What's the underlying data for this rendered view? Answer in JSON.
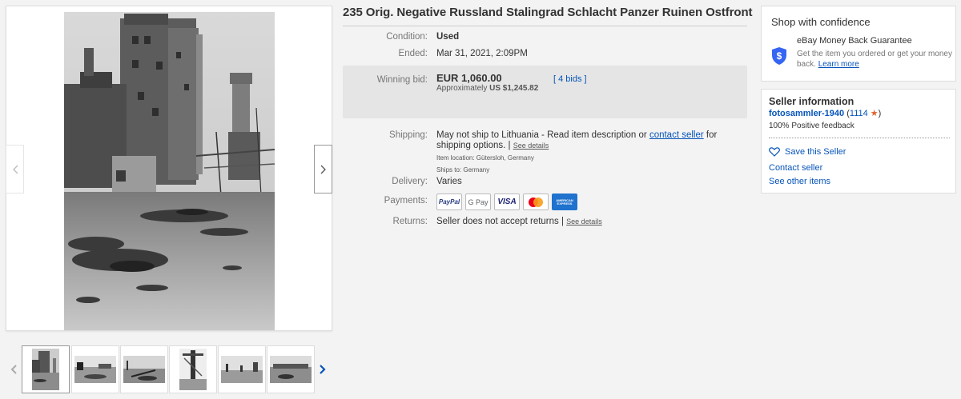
{
  "item": {
    "title": "235 Orig. Negative Russland Stalingrad Schlacht Panzer Ruinen Ostfront",
    "condition_label": "Condition:",
    "condition_value": "Used",
    "ended_label": "Ended:",
    "ended_value": "Mar 31, 2021, 2:09PM",
    "winning_label": "Winning bid:",
    "winning_value": "EUR 1,060.00",
    "approx_prefix": "Approximately",
    "approx_value": "US $1,245.82",
    "bids_open": "[",
    "bids_link": "4 bids",
    "bids_close": "]",
    "shipping_label": "Shipping:",
    "shipping_text": "May not ship to Lithuania - Read item description or",
    "contact_seller_link": "contact seller",
    "shipping_text_2": "for shipping",
    "shipping_text_3": "options. |",
    "see_details": "See details",
    "item_location": "Item location:  Gütersloh, Germany",
    "ships_to": "Ships to:  Germany",
    "delivery_label": "Delivery:",
    "delivery_value": "Varies",
    "payments_label": "Payments:",
    "payment_methods": [
      "PayPal",
      "G Pay",
      "VISA",
      "Mastercard",
      "AMERICAN EXPRESS"
    ],
    "returns_label": "Returns:",
    "returns_value": "Seller does not accept returns |",
    "returns_see_details": "See details"
  },
  "confidence": {
    "title": "Shop with confidence",
    "guarantee_title": "eBay Money Back Guarantee",
    "guarantee_text": "Get the item you ordered or get your money back.",
    "learn_more": "Learn more",
    "icon": "shield-check-icon"
  },
  "seller": {
    "title": "Seller information",
    "name": "fotosammler-1940",
    "score_open": "(",
    "score": "1114",
    "score_close": ")",
    "feedback": "100% Positive feedback",
    "save_label": "Save this Seller",
    "contact_label": "Contact seller",
    "other_items_label": "See other items"
  },
  "gallery": {
    "thumbnail_count": 6,
    "active_thumbnail": 1
  },
  "colors": {
    "link": "#0654ba",
    "star": "#e0632e",
    "shield": "#3665f3"
  }
}
